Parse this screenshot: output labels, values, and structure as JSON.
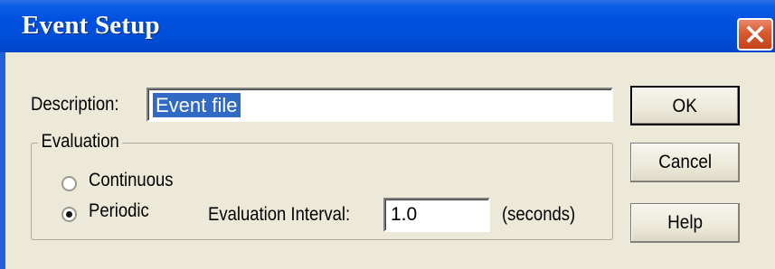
{
  "window": {
    "title": "Event Setup"
  },
  "description": {
    "label": "Description:",
    "value": "Event file"
  },
  "evaluation": {
    "legend": "Evaluation",
    "options": [
      {
        "label": "Continuous",
        "selected": false
      },
      {
        "label": "Periodic",
        "selected": true
      }
    ],
    "interval_label": "Evaluation Interval:",
    "interval_value": "1.0",
    "interval_unit": "(seconds)"
  },
  "buttons": {
    "ok": "OK",
    "cancel": "Cancel",
    "help": "Help"
  },
  "icons": {
    "close": "close-icon"
  },
  "colors": {
    "titlebar": "#0050e0",
    "dialog_bg": "#ece9d8",
    "selection": "#316ac5",
    "close_button": "#d95a31"
  }
}
